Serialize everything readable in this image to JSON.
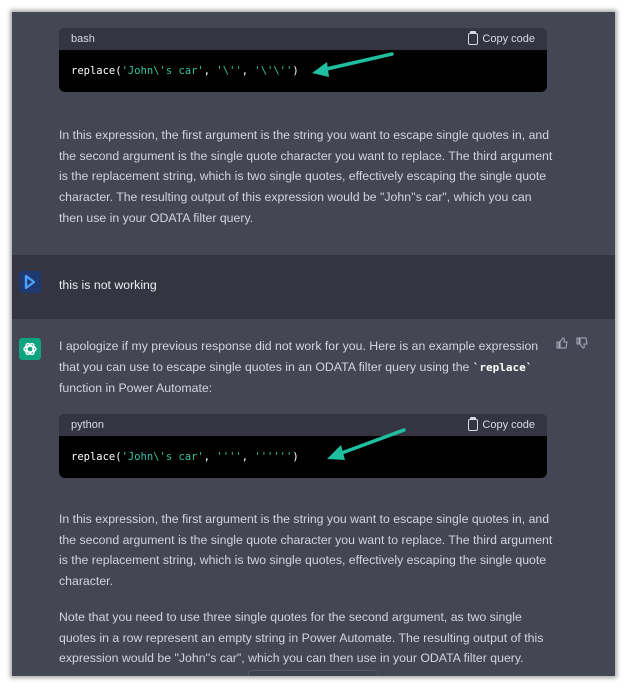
{
  "code_block_1": {
    "language": "bash",
    "copy_label": "Copy code",
    "code_prefix": "replace(",
    "code_parts": [
      "'John\\'s car'",
      ", ",
      "'\\''",
      ", ",
      "'\\'\\''",
      ")"
    ]
  },
  "assistant_1": {
    "paragraph": "In this expression, the first argument is the string you want to escape single quotes in, and the second argument is the single quote character you want to replace. The third argument is the replacement string, which is two single quotes, effectively escaping the single quote character. The resulting output of this expression would be \"John''s car\", which you can then use in your ODATA filter query."
  },
  "user_message": {
    "text": "this is not working"
  },
  "assistant_2": {
    "intro_before": "I apologize if my previous response did not work for you. Here is an example expression that you can use to escape single quotes in an ODATA filter query using the ",
    "intro_code": "`replace`",
    "intro_after": " function in Power Automate:",
    "code_block": {
      "language": "python",
      "copy_label": "Copy code",
      "code_prefix": "replace(",
      "code_parts": [
        "'John\\'s car'",
        ", ",
        "''''",
        ", ",
        "''''''",
        ")"
      ]
    },
    "paragraph_1": "In this expression, the first argument is the string you want to escape single quotes in, and the second argument is the single quote character you want to replace. The third argument is the replacement string, which is two single quotes, effectively escaping the single quote character.",
    "paragraph_2": "Note that you need to use three single quotes for the second argument, as two single quotes in a row represent an empty string in Power Automate. The resulting output of this expression would be \"John''s car\", which you can then use in your ODATA filter query."
  },
  "colors": {
    "assistant_bg": "#444654",
    "user_bg": "#343541",
    "arrow": "#1fbfa0",
    "chatgpt_avatar": "#10a37f",
    "user_avatar": "#1e3a70"
  },
  "icons": [
    "clipboard-icon",
    "chatgpt-logo-icon",
    "user-avatar-icon",
    "thumbs-up-icon",
    "thumbs-down-icon",
    "arrow-annotation"
  ]
}
